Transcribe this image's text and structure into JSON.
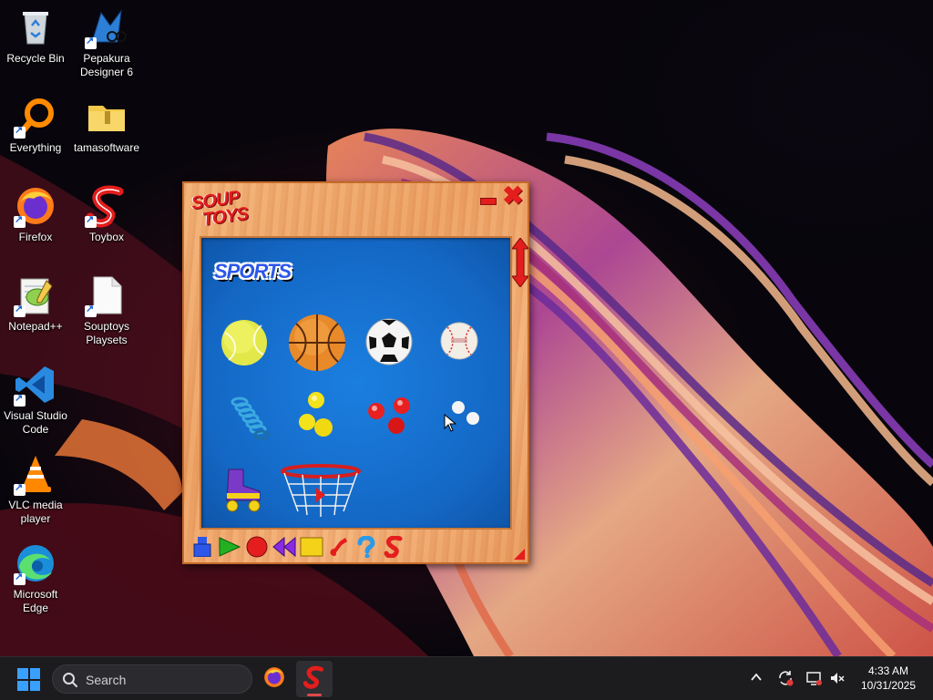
{
  "desktop": {
    "icons": [
      {
        "label": "Recycle Bin",
        "icon": "recycle-bin-icon"
      },
      {
        "label": "Pepakura Designer 6",
        "icon": "pepakura-icon"
      },
      {
        "label": "Everything",
        "icon": "everything-search-icon"
      },
      {
        "label": "tamasoftware",
        "icon": "folder-icon"
      },
      {
        "label": "Firefox",
        "icon": "firefox-icon"
      },
      {
        "label": "Toybox",
        "icon": "toybox-icon"
      },
      {
        "label": "Notepad++",
        "icon": "notepad-plus-plus-icon"
      },
      {
        "label": "Souptoys Playsets",
        "icon": "document-icon"
      },
      {
        "label": "Visual Studio Code",
        "icon": "vscode-icon"
      },
      {
        "label": "VLC media player",
        "icon": "vlc-icon"
      },
      {
        "label": "Microsoft Edge",
        "icon": "edge-icon"
      }
    ]
  },
  "app": {
    "logo_line1": "SOUP",
    "logo_line2": "TOYS",
    "category_title": "SPORTS",
    "toys": [
      "tennis-ball",
      "basketball",
      "soccer-ball",
      "baseball",
      "slinky",
      "yellow-balls",
      "red-balls",
      "white-balls",
      "roller-skate",
      "basketball-hoop"
    ],
    "toolbar": [
      "stamp-tool-icon",
      "play-icon",
      "record-icon",
      "rewind-icon",
      "stop-icon",
      "note-icon",
      "help-icon",
      "soup-s-icon"
    ],
    "colors": {
      "accent_red": "#e41d1d",
      "playfield_blue": "#1467c4",
      "frame_orange": "#eda164"
    }
  },
  "taskbar": {
    "search_placeholder": "Search",
    "pinned": [
      "firefox-icon",
      "toybox-icon"
    ],
    "clock_time": "4:33 AM",
    "clock_date": "10/31/2025"
  }
}
